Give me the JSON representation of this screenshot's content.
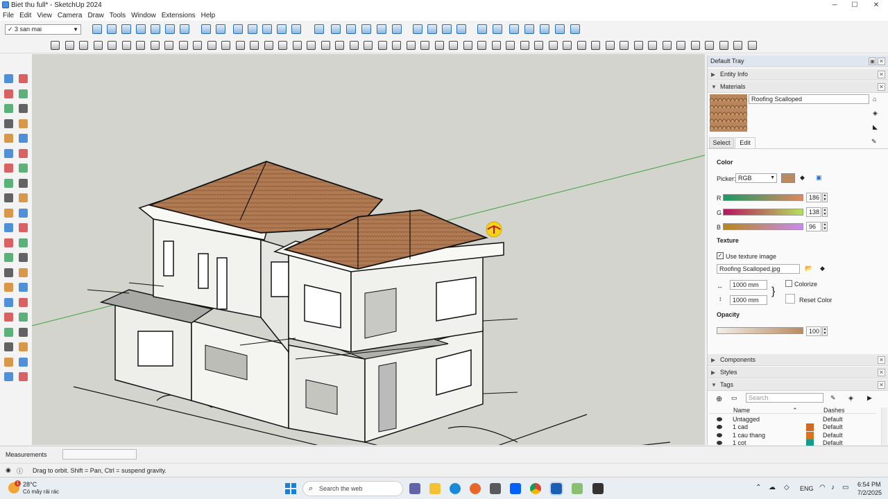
{
  "window": {
    "title": "Biet thu full* - SketchUp 2024",
    "minimize": "─",
    "maximize": "☐",
    "close": "✕"
  },
  "menu": [
    "File",
    "Edit",
    "View",
    "Camera",
    "Draw",
    "Tools",
    "Window",
    "Extensions",
    "Help"
  ],
  "toolbar": {
    "scene_value": "✓ 3 san mai"
  },
  "tray": {
    "title": "Default Tray",
    "entity_info": "Entity Info",
    "materials": "Materials",
    "material_name": "Roofing Scalloped",
    "tabs": {
      "select": "Select",
      "edit": "Edit"
    },
    "color_heading": "Color",
    "picker_label": "Picker:",
    "picker_value": "RGB",
    "r_label": "R",
    "g_label": "G",
    "b_label": "B",
    "r_value": "186",
    "g_value": "138",
    "b_value": "96",
    "material_color": "#ba8a60",
    "texture_heading": "Texture",
    "use_texture": "Use texture image",
    "texture_file": "Roofing Scalloped.jpg",
    "width_value": "1000 mm",
    "height_value": "1000 mm",
    "colorize": "Colorize",
    "reset_color": "Reset Color",
    "opacity_heading": "Opacity",
    "opacity_value": "100",
    "components": "Components",
    "styles": "Styles",
    "tags": "Tags",
    "tags_search_placeholder": "Search",
    "col_name": "Name",
    "col_dashes": "Dashes",
    "tag_rows": [
      {
        "name": "Untagged",
        "dashes": "Default",
        "color": ""
      },
      {
        "name": "1 cad",
        "dashes": "Default",
        "color": "#d2691e"
      },
      {
        "name": "1 cau thang",
        "dashes": "Default",
        "color": "#d9731c"
      },
      {
        "name": "1 cot",
        "dashes": "Default",
        "color": "#1a9a8a"
      }
    ]
  },
  "status": {
    "measurements_label": "Measurements",
    "hint": "Drag to orbit. Shift = Pan, Ctrl = suspend gravity."
  },
  "taskbar": {
    "weather_temp": "28°C",
    "weather_desc": "Có mây rải rác",
    "weather_badge": "1",
    "search_placeholder": "Search the web",
    "lang": "ENG",
    "time": "6:54 PM",
    "date": "7/2/2025"
  }
}
